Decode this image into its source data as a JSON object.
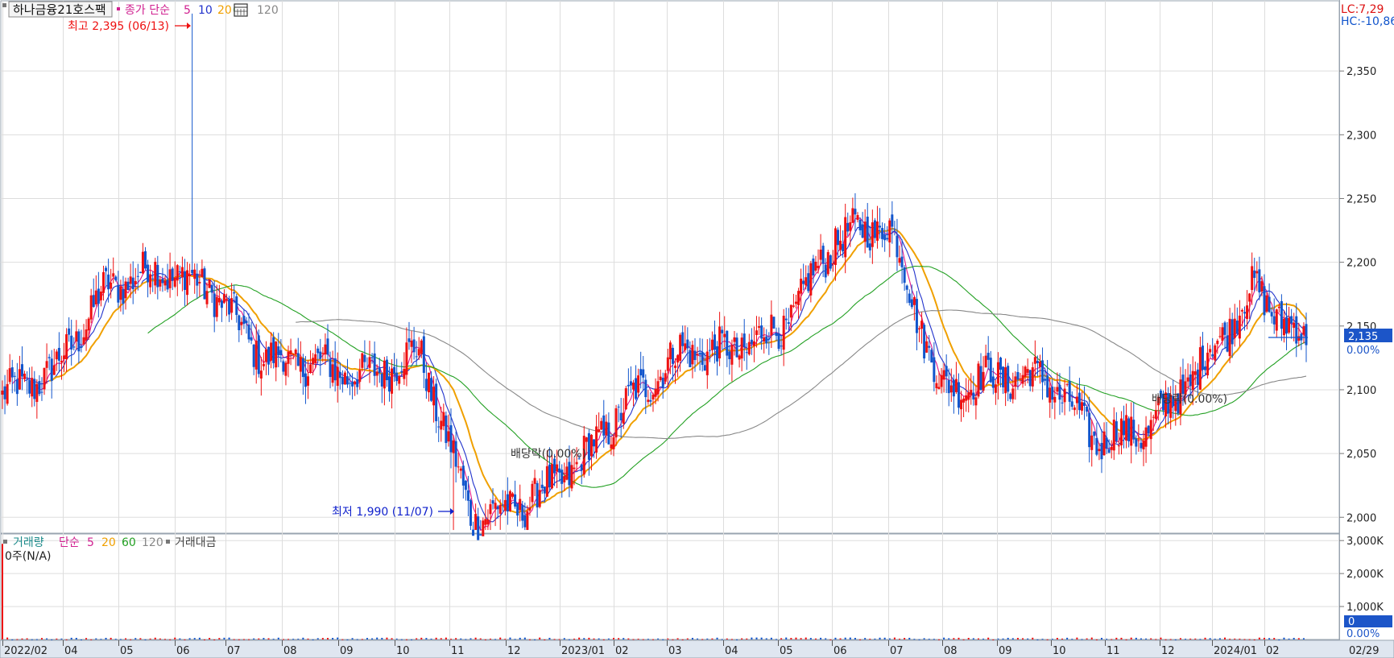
{
  "legend": {
    "name": "하나금융21호스팩",
    "ma_label": "종가 단순",
    "ma_periods": [
      "5",
      "10",
      "20",
      "60",
      "120"
    ],
    "ma_colors": [
      "#e0188c",
      "#2233cc",
      "#f0a000",
      "#22a022",
      "#888888"
    ]
  },
  "volume_legend": {
    "name": "거래량",
    "ma_label": "단순",
    "ma_periods": [
      "5",
      "20",
      "60",
      "120"
    ],
    "amount_label": "거래대금",
    "status_text": "0주(N/A)"
  },
  "right_info": {
    "lc": "LC:7,29",
    "hc": "HC:-10,86"
  },
  "annotations": {
    "high": "최고 2,395 (06/13)",
    "low": "최저 1,990 (11/07)",
    "dividend1": "배당락(0.00%)",
    "dividend2": "배당락(0.00%)"
  },
  "current_price": {
    "label": "2,135",
    "pct": "0.00%"
  },
  "volume_current": {
    "label": "0",
    "pct": "0.00%"
  },
  "last_date_label": "02/29",
  "colors": {
    "up": "#ee1111",
    "down": "#1155cc",
    "grid": "#dddddd",
    "axis_bg": "#dfe6f0"
  },
  "chart_data": {
    "type": "candlestick",
    "title": "하나금융21호스팩",
    "price_axis": {
      "ticks": [
        2000,
        2050,
        2100,
        2150,
        2200,
        2250,
        2300,
        2350
      ],
      "range": [
        1985,
        2400
      ]
    },
    "volume_axis": {
      "ticks": [
        "1,000K",
        "2,000K",
        "3,000K"
      ],
      "values": [
        1000,
        2000,
        3000
      ],
      "unit": "K"
    },
    "x_axis": {
      "labels": [
        "2022/02",
        "04",
        "05",
        "06",
        "07",
        "08",
        "09",
        "10",
        "11",
        "12",
        "2023/01",
        "02",
        "03",
        "04",
        "05",
        "06",
        "07",
        "08",
        "09",
        "10",
        "11",
        "12",
        "2024/01",
        "02"
      ],
      "range": [
        "2022/02",
        "2024/02"
      ]
    },
    "close_path": [
      [
        "2022/02",
        2095
      ],
      [
        "2022/03",
        2115
      ],
      [
        "2022/04",
        2180
      ],
      [
        "2022/05",
        2195
      ],
      [
        "2022/06",
        2180
      ],
      [
        "2022/07",
        2125
      ],
      [
        "2022/08",
        2120
      ],
      [
        "2022/09",
        2110
      ],
      [
        "2022/10",
        2130
      ],
      [
        "2022/11",
        2000
      ],
      [
        "2022/12",
        2010
      ],
      [
        "2023/01",
        2040
      ],
      [
        "2023/02",
        2090
      ],
      [
        "2023/03",
        2130
      ],
      [
        "2023/04",
        2130
      ],
      [
        "2023/05",
        2150
      ],
      [
        "2023/06",
        2220
      ],
      [
        "2023/07",
        2230
      ],
      [
        "2023/08",
        2100
      ],
      [
        "2023/09",
        2110
      ],
      [
        "2023/10",
        2110
      ],
      [
        "2023/11",
        2060
      ],
      [
        "2023/12",
        2070
      ],
      [
        "2024/01",
        2120
      ],
      [
        "2024/02",
        2180
      ],
      [
        "2024/02/29",
        2135
      ]
    ],
    "extremes": {
      "high": {
        "value": 2395,
        "date": "06/13"
      },
      "low": {
        "value": 1990,
        "date": "11/07"
      }
    },
    "last_close": 2135
  }
}
